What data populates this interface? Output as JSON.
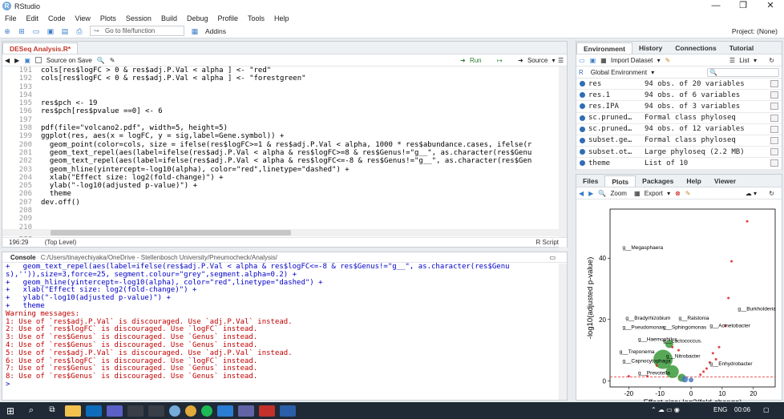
{
  "app": {
    "title": "RStudio",
    "project": "Project: (None)"
  },
  "menu": [
    "File",
    "Edit",
    "Code",
    "View",
    "Plots",
    "Session",
    "Build",
    "Debug",
    "Profile",
    "Tools",
    "Help"
  ],
  "toolbar": {
    "goto_placeholder": "Go to file/function",
    "addins": "Addins"
  },
  "editor": {
    "tab": "DESeq Analysis.R*",
    "source_on_save": "Source on Save",
    "run": "Run",
    "source": "Source",
    "line_numbers": [
      "191",
      "192",
      "193",
      "194",
      "195",
      "196",
      "197",
      "198",
      "199",
      "200",
      "201",
      "202",
      "203",
      "204",
      "205",
      "206",
      "207",
      "208",
      "209",
      "210",
      "211"
    ],
    "lines": [
      "cols[res$logFC > 0 & res$adj.P.Val < alpha ] <- \"red\"",
      "cols[res$logFC < 0 & res$adj.P.Val < alpha ] <- \"forestgreen\"",
      "",
      "",
      "res$pch <- 19",
      "res$pch[res$pvalue ==0] <- 6",
      "",
      "pdf(file=\"volcano2.pdf\", width=5, height=5)",
      "ggplot(res, aes(x = logFC, y = sig,label=Gene.symbol)) +",
      "  geom_point(color=cols, size = ifelse(res$logFC>=1 & res$adj.P.Val < alpha, 1000 * res$abundance.cases, ifelse(r",
      "  geom_text_repel(aes(label=ifelse(res$adj.P.Val < alpha & res$logFC>=8 & res$Genus!=\"g__\", as.character(res$Genu",
      "  geom_text_repel(aes(label=ifelse(res$adj.P.Val < alpha & res$logFC<=-8 & res$Genus!=\"g__\", as.character(res$Gen",
      "  geom_hline(yintercept=-log10(alpha), color=\"red\",linetype=\"dashed\") +",
      "  xlab(\"Effect size: log2(fold-change)\") +",
      "  ylab(\"-log10(adjusted p-value)\") +",
      "  theme",
      "dev.off()",
      "",
      "",
      "",
      ""
    ],
    "cursor": "196:29",
    "scope": "(Top Level)",
    "filetype": "R Script"
  },
  "console": {
    "tab": "Console",
    "path": "C:/Users/tinayechiyaka/OneDrive - Stellenbosch University/Pneumocheck/Analysis/",
    "lines": [
      {
        "t": "+   geom_text_repel(aes(label=ifelse(res$adj.P.Val < alpha & res$logFC<=-8 & res$Genus!=\"g__\", as.character(res$Genu",
        "c": "blue"
      },
      {
        "t": "s),'')),size=3,force=25, segment.colour=\"grey\",segment.alpha=0.2) +",
        "c": "blue"
      },
      {
        "t": "+   geom_hline(yintercept=-log10(alpha), color=\"red\",linetype=\"dashed\") +",
        "c": "blue"
      },
      {
        "t": "+   xlab(\"Effect size: log2(fold-change)\") +",
        "c": "blue"
      },
      {
        "t": "+   ylab(\"-log10(adjusted p-value)\") +",
        "c": "blue"
      },
      {
        "t": "+   theme",
        "c": "blue"
      },
      {
        "t": "Warning messages:",
        "c": "red"
      },
      {
        "t": "1: Use of `res$adj.P.Val` is discouraged. Use `adj.P.Val` instead.",
        "c": "red"
      },
      {
        "t": "2: Use of `res$logFC` is discouraged. Use `logFC` instead.",
        "c": "red"
      },
      {
        "t": "3: Use of `res$Genus` is discouraged. Use `Genus` instead.",
        "c": "red"
      },
      {
        "t": "4: Use of `res$Genus` is discouraged. Use `Genus` instead.",
        "c": "red"
      },
      {
        "t": "5: Use of `res$adj.P.Val` is discouraged. Use `adj.P.Val` instead.",
        "c": "red"
      },
      {
        "t": "6: Use of `res$logFC` is discouraged. Use `logFC` instead.",
        "c": "red"
      },
      {
        "t": "7: Use of `res$Genus` is discouraged. Use `Genus` instead.",
        "c": "red"
      },
      {
        "t": "8: Use of `res$Genus` is discouraged. Use `Genus` instead.",
        "c": "red"
      },
      {
        "t": ">",
        "c": "blue"
      }
    ]
  },
  "environment": {
    "tabs": [
      "Environment",
      "History",
      "Connections",
      "Tutorial"
    ],
    "import": "Import Dataset",
    "list": "List",
    "scope": "Global Environment",
    "rows": [
      {
        "name": "res",
        "value": "94 obs. of 20 variables"
      },
      {
        "name": "res.1",
        "value": "94 obs. of 6 variables"
      },
      {
        "name": "res.IPA",
        "value": "94 obs. of 3 variables"
      },
      {
        "name": "sc.pruned…",
        "value": "Formal class phyloseq"
      },
      {
        "name": "sc.pruned…",
        "value": "94 obs. of 12 variables"
      },
      {
        "name": "subset.ge…",
        "value": "Formal class phyloseq"
      },
      {
        "name": "subset.ot…",
        "value": "Large phyloseq (2.2 MB)"
      },
      {
        "name": "theme",
        "value": "List of 10"
      }
    ]
  },
  "files": {
    "tabs": [
      "Files",
      "Plots",
      "Packages",
      "Help",
      "Viewer"
    ],
    "zoom": "Zoom",
    "export": "Export"
  },
  "chart_data": {
    "type": "scatter",
    "xlabel": "Effect size: log2(fold-change)",
    "ylabel": "-log10(adjusted p-value)",
    "xlim": [
      -26,
      27
    ],
    "ylim": [
      -2,
      56
    ],
    "xticks": [
      -20,
      -10,
      0,
      10,
      20
    ],
    "yticks": [
      0,
      20,
      40
    ],
    "hline": 1.3,
    "points": [
      {
        "x": -9,
        "y": 7,
        "r": 12,
        "color": "#3a9a3a"
      },
      {
        "x": -6,
        "y": 3,
        "r": 8,
        "color": "#3a9a3a"
      },
      {
        "x": -3,
        "y": 1,
        "r": 5,
        "color": "#3a9a3a"
      },
      {
        "x": -7,
        "y": 12,
        "r": 5,
        "color": "#3a9a3a"
      },
      {
        "x": -2,
        "y": 0.5,
        "r": 4,
        "color": "#4a7ac0"
      },
      {
        "x": 0,
        "y": 0.3,
        "r": 3,
        "color": "#4a7ac0"
      },
      {
        "x": 18,
        "y": 52,
        "r": 1.5,
        "color": "#e02020"
      },
      {
        "x": 13,
        "y": 39,
        "r": 1.5,
        "color": "#e02020"
      },
      {
        "x": 12,
        "y": 27,
        "r": 1.5,
        "color": "#e02020"
      },
      {
        "x": 11,
        "y": 18,
        "r": 1.5,
        "color": "#e02020"
      },
      {
        "x": 7,
        "y": 9,
        "r": 1.5,
        "color": "#e02020"
      },
      {
        "x": 6,
        "y": 6,
        "r": 1.5,
        "color": "#e02020"
      },
      {
        "x": 5,
        "y": 4,
        "r": 1.5,
        "color": "#e02020"
      },
      {
        "x": 4,
        "y": 3,
        "r": 1.5,
        "color": "#e02020"
      },
      {
        "x": 8,
        "y": 7,
        "r": 1.5,
        "color": "#e02020"
      },
      {
        "x": 3,
        "y": 2,
        "r": 1.5,
        "color": "#e02020"
      },
      {
        "x": 9,
        "y": 11,
        "r": 1.5,
        "color": "#e02020"
      },
      {
        "x": -4,
        "y": 10,
        "r": 1.5,
        "color": "#e02020"
      },
      {
        "x": -20,
        "y": 1.5,
        "r": 1.5,
        "color": "#e02020"
      },
      {
        "x": -14,
        "y": 1.5,
        "r": 1.5,
        "color": "#e02020"
      },
      {
        "x": -11,
        "y": 5,
        "r": 1.5,
        "color": "#e02020"
      },
      {
        "x": -6,
        "y": 11,
        "r": 1.5,
        "color": "#e02020"
      }
    ],
    "annotations": [
      {
        "text": "g__Megasphaera",
        "x": -22,
        "y": 43
      },
      {
        "text": "g__Burkholderia",
        "x": 15,
        "y": 23
      },
      {
        "text": "g__Bradyrhizobium",
        "x": -21,
        "y": 20
      },
      {
        "text": "g__Ralstonia",
        "x": -4,
        "y": 20
      },
      {
        "text": "g__Pseudomonas",
        "x": -22,
        "y": 17
      },
      {
        "text": "g__Sphingomonas",
        "x": -9,
        "y": 17
      },
      {
        "text": "g__Acinetobacter",
        "x": 6,
        "y": 17.5
      },
      {
        "text": "g__Haemophilus",
        "x": -17,
        "y": 13
      },
      {
        "text": "g__Lactococcus.",
        "x": -9,
        "y": 12.5
      },
      {
        "text": "g__Treponema",
        "x": -23,
        "y": 9
      },
      {
        "text": "g__Nitrobacter",
        "x": -8,
        "y": 7.5
      },
      {
        "text": "g__Capnocytophaga",
        "x": -22,
        "y": 6
      },
      {
        "text": "g__Enhydrobacter",
        "x": 6,
        "y": 5
      },
      {
        "text": "g__Prevotella",
        "x": -17,
        "y": 2
      }
    ]
  },
  "taskbar": {
    "lang": "ENG",
    "time": "00:06"
  }
}
